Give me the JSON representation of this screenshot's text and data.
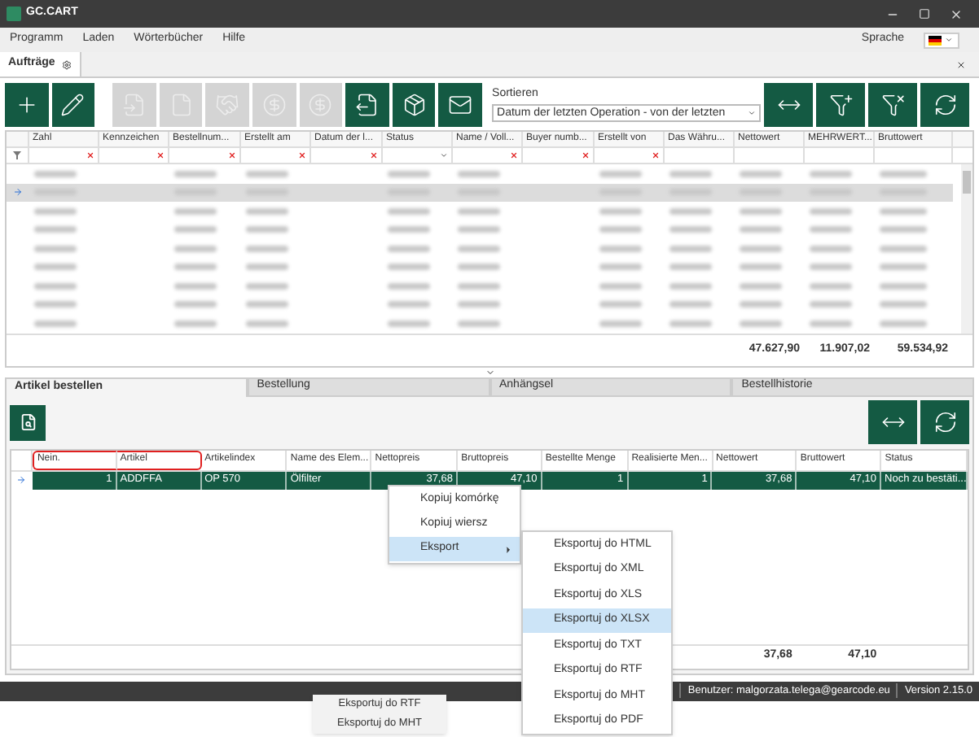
{
  "window": {
    "title": "GC.CART"
  },
  "menu": [
    "Programm",
    "Laden",
    "Wörterbücher",
    "Hilfe"
  ],
  "language": {
    "label": "Sprache"
  },
  "document_tabs": [
    {
      "label": "Aufträge",
      "selected": true
    }
  ],
  "toolbar": [
    {
      "kind": "add",
      "disabled": false
    },
    {
      "kind": "edit",
      "disabled": false
    },
    {
      "kind": "doc-in",
      "disabled": true
    },
    {
      "kind": "doc",
      "disabled": true
    },
    {
      "kind": "handshake",
      "disabled": true
    },
    {
      "kind": "coin-back",
      "disabled": true
    },
    {
      "kind": "coin",
      "disabled": true
    },
    {
      "kind": "doc-out",
      "disabled": false
    },
    {
      "kind": "box",
      "disabled": false
    },
    {
      "kind": "mail",
      "disabled": false
    }
  ],
  "sort": {
    "label": "Sortieren",
    "value": "Datum der letzten Operation - von der letzten"
  },
  "right_tools": [
    {
      "kind": "fit"
    },
    {
      "kind": "filter-add"
    },
    {
      "kind": "filter-clear"
    },
    {
      "kind": "refresh"
    }
  ],
  "orders_table": {
    "columns": [
      {
        "label": "Zahl",
        "filter_clear": true,
        "filter_dropdown": false
      },
      {
        "label": "Kennzeichen",
        "filter_clear": true,
        "filter_dropdown": false
      },
      {
        "label": "Bestellnum...",
        "filter_clear": true,
        "filter_dropdown": false
      },
      {
        "label": "Erstellt am",
        "filter_clear": true,
        "filter_dropdown": false
      },
      {
        "label": "Datum der l...",
        "filter_clear": true,
        "filter_dropdown": false
      },
      {
        "label": "Status",
        "filter_clear": false,
        "filter_dropdown": true
      },
      {
        "label": "Name / Voll...",
        "filter_clear": true,
        "filter_dropdown": false
      },
      {
        "label": "Buyer numb...",
        "filter_clear": true,
        "filter_dropdown": false
      },
      {
        "label": "Erstellt von",
        "filter_clear": true,
        "filter_dropdown": false
      },
      {
        "label": "Das Währu...",
        "filter_clear": false,
        "filter_dropdown": false
      },
      {
        "label": "Nettowert",
        "filter_clear": false,
        "filter_dropdown": false,
        "total": "47.627,90"
      },
      {
        "label": "MEHRWERT...",
        "filter_clear": false,
        "filter_dropdown": false,
        "total": "11.907,02"
      },
      {
        "label": "Bruttowert",
        "filter_clear": false,
        "filter_dropdown": false,
        "total": "59.534,92"
      }
    ],
    "rows": [
      {
        "selected": false
      },
      {
        "selected": true
      },
      {
        "selected": false
      },
      {
        "selected": false
      },
      {
        "selected": false
      },
      {
        "selected": false
      },
      {
        "selected": false
      },
      {
        "selected": false
      },
      {
        "selected": false
      }
    ]
  },
  "detail_tabs": [
    {
      "label": "Artikel bestellen",
      "selected": true
    },
    {
      "label": "Bestellung",
      "selected": false
    },
    {
      "label": "Anhängsel",
      "selected": false
    },
    {
      "label": "Bestellhistorie",
      "selected": false
    }
  ],
  "items_table": {
    "columns": [
      {
        "label": "Nein.",
        "highlighted": true
      },
      {
        "label": "Artikel",
        "highlighted": true
      },
      {
        "label": "Artikelindex",
        "highlighted": false
      },
      {
        "label": "Name des Elem...",
        "highlighted": false
      },
      {
        "label": "Nettopreis",
        "highlighted": false
      },
      {
        "label": "Bruttopreis",
        "highlighted": false
      },
      {
        "label": "Bestellte Menge",
        "highlighted": false
      },
      {
        "label": "Realisierte Men...",
        "highlighted": false
      },
      {
        "label": "Nettowert",
        "highlighted": false,
        "total": "37,68"
      },
      {
        "label": "Bruttowert",
        "highlighted": false,
        "total": "47,10"
      },
      {
        "label": "Status",
        "highlighted": false
      }
    ],
    "rows": [
      {
        "selected": true,
        "cells": [
          "1",
          "ADDFFA",
          "OP 570",
          "Ölfilter",
          "37,68",
          "47,10",
          "1",
          "1",
          "37,68",
          "47,10",
          "Noch zu bestäti..."
        ]
      }
    ]
  },
  "context_menu": [
    {
      "label": "Kopiuj komórkę",
      "selected": false,
      "submenu": false
    },
    {
      "label": "Kopiuj wiersz",
      "selected": false,
      "submenu": false
    },
    {
      "label": "Eksport",
      "selected": true,
      "submenu": true
    }
  ],
  "export_submenu": [
    {
      "label": "Eksportuj do HTML",
      "selected": false
    },
    {
      "label": "Eksportuj do XML",
      "selected": false
    },
    {
      "label": "Eksportuj do XLS",
      "selected": false
    },
    {
      "label": "Eksportuj do XLSX",
      "selected": true
    },
    {
      "label": "Eksportuj do TXT",
      "selected": false
    },
    {
      "label": "Eksportuj do RTF",
      "selected": false
    },
    {
      "label": "Eksportuj do MHT",
      "selected": false
    },
    {
      "label": "Eksportuj do PDF",
      "selected": false
    }
  ],
  "status_bar": {
    "user": "Benutzer: malgorzata.telega@gearcode.eu",
    "version": "Version 2.15.0"
  },
  "ghost_menu": [
    "Eksportuj do RTF",
    "Eksportuj do MHT"
  ]
}
